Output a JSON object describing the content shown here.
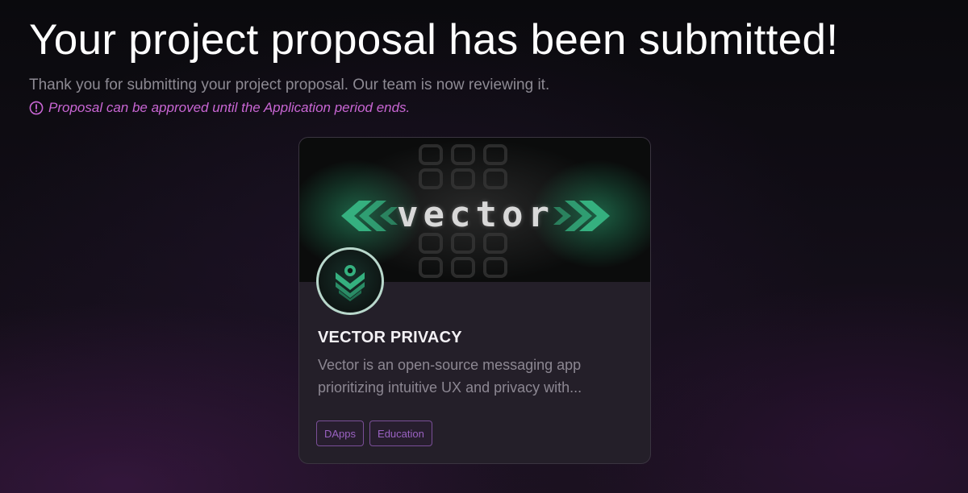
{
  "header": {
    "title": "Your project proposal has been submitted!",
    "subtitle": "Thank you for submitting your project proposal. Our team is now reviewing it.",
    "notice": "Proposal can be approved until the Application period ends.",
    "notice_icon": "alert-circle-icon"
  },
  "project_card": {
    "banner_wordmark": "vector",
    "logo_icon": "vector-shield-logo",
    "name": "VECTOR PRIVACY",
    "description": "Vector is an open-source messaging app prioritizing intuitive UX and privacy with...",
    "tags": [
      "DApps",
      "Education"
    ]
  },
  "colors": {
    "accent_pink": "#c966d4",
    "tag_purple": "#9a62c2",
    "brand_green": "#35b07f"
  }
}
